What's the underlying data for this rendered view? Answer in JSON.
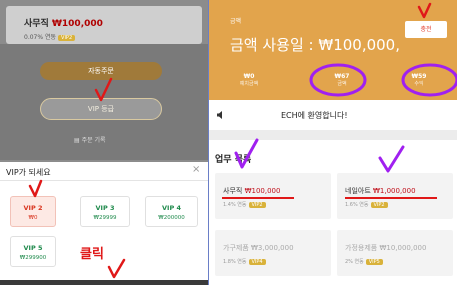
{
  "left": {
    "job_name": "사무직",
    "job_price": "₩100,000",
    "job_rate": "0.07%",
    "job_rate_suffix": "연동",
    "badge": "VIP2",
    "auto_button": "자동주문",
    "vip_button": "VIP 등급",
    "record_link": "주문 기록",
    "popup": {
      "title": "VIP가 되세요",
      "close": "×",
      "options": [
        {
          "name": "VIP 2",
          "price": "₩0",
          "selected": true
        },
        {
          "name": "VIP 3",
          "price": "₩29999",
          "selected": false
        },
        {
          "name": "VIP 4",
          "price": "₩200000",
          "selected": false
        },
        {
          "name": "VIP 5",
          "price": "₩299900",
          "selected": false
        }
      ],
      "click_annotation": "클릭"
    }
  },
  "right": {
    "header_small": "금액",
    "header_title": "금액 사용일 : ₩100,000,",
    "charge_button": "충전",
    "stats": [
      {
        "value": "₩0",
        "label": "예치금액"
      },
      {
        "value": "₩67",
        "label": "금액"
      },
      {
        "value": "₩59",
        "label": "수익"
      }
    ],
    "notice": "ECH에 환영합니다!",
    "tasks_title": "업무 목록",
    "tasks": [
      {
        "name": "사무직",
        "price": "₩100,000",
        "rate": "1.4% 연동",
        "badge": "VIP2",
        "dim": false
      },
      {
        "name": "네일아트",
        "price": "₩1,000,000",
        "rate": "1.6% 연동",
        "badge": "VIP2",
        "dim": false
      },
      {
        "name": "가구제품",
        "price": "₩3,000,000",
        "rate": "1.8% 연동",
        "badge": "VIP4",
        "dim": true
      },
      {
        "name": "가정용제품",
        "price": "₩10,000,000",
        "rate": "2% 연동",
        "badge": "VIP5",
        "dim": true
      }
    ]
  },
  "colors": {
    "header_orange": "#e2a44c",
    "annotation_red": "#e01818",
    "annotation_purple": "#a020f0",
    "vip_green": "#1f8a4c"
  }
}
